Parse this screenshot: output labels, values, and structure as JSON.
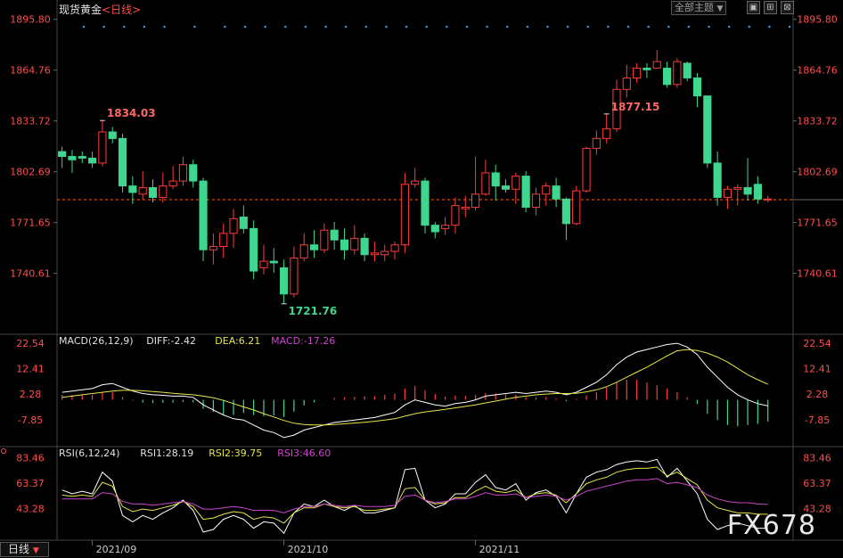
{
  "header": {
    "title": "现货黄金",
    "period_tag": "<日线>",
    "theme_button": "全部主题",
    "theme_arrow": "▼",
    "win_buttons": [
      "▣",
      "⊞",
      "⊠"
    ]
  },
  "bottom": {
    "period_button": "日线",
    "watermark": "FX678"
  },
  "colors": {
    "up": "#ff3b3b",
    "down": "#3fd68f",
    "diff": "#ffffff",
    "dea": "#e6e64a",
    "macd_label": "#cc44cc",
    "rsi1": "#ffffff",
    "rsi2": "#e6e64a",
    "rsi3": "#cc44cc",
    "axis_text": "#ff4d4d",
    "date_text": "#cccccc",
    "ref_line": "#ff6600",
    "dots": "#3a8fd8"
  },
  "chart_data": [
    {
      "type": "candlestick",
      "name": "现货黄金 日线",
      "y_ticks": [
        "1895.80",
        "1864.76",
        "1833.72",
        "1802.69",
        "1771.65",
        "1740.61"
      ],
      "ylim": [
        1705,
        1900
      ],
      "x_ticks": [
        "2021/09",
        "2021/10",
        "2021/11"
      ],
      "current_price_line": 1785.6,
      "annotations": [
        {
          "label": "1834.03",
          "index": 4,
          "kind": "high"
        },
        {
          "label": "1721.76",
          "index": 22,
          "kind": "low"
        },
        {
          "label": "1877.15",
          "index": 54,
          "kind": "high"
        }
      ],
      "candles": [
        [
          1815,
          1812,
          1818,
          1805
        ],
        [
          1812,
          1810,
          1816,
          1802
        ],
        [
          1812,
          1811,
          1815,
          1808
        ],
        [
          1811,
          1808,
          1815,
          1805
        ],
        [
          1808,
          1827,
          1834,
          1806
        ],
        [
          1827,
          1823,
          1830,
          1820
        ],
        [
          1823,
          1794,
          1826,
          1790
        ],
        [
          1794,
          1790,
          1800,
          1783
        ],
        [
          1789,
          1793,
          1803,
          1786
        ],
        [
          1793,
          1787,
          1798,
          1784
        ],
        [
          1787,
          1794,
          1802,
          1784
        ],
        [
          1794,
          1797,
          1806,
          1792
        ],
        [
          1797,
          1807,
          1812,
          1794
        ],
        [
          1807,
          1797,
          1810,
          1793
        ],
        [
          1797,
          1755,
          1799,
          1748
        ],
        [
          1755,
          1757,
          1765,
          1746
        ],
        [
          1757,
          1765,
          1771,
          1750
        ],
        [
          1765,
          1774,
          1780,
          1756
        ],
        [
          1775,
          1768,
          1782,
          1765
        ],
        [
          1768,
          1742,
          1773,
          1737
        ],
        [
          1744,
          1748,
          1758,
          1740
        ],
        [
          1748,
          1747,
          1756,
          1741
        ],
        [
          1744,
          1728,
          1749,
          1722
        ],
        [
          1728,
          1750,
          1757,
          1726
        ],
        [
          1750,
          1758,
          1765,
          1748
        ],
        [
          1758,
          1755,
          1767,
          1750
        ],
        [
          1755,
          1767,
          1771,
          1753
        ],
        [
          1767,
          1761,
          1772,
          1755
        ],
        [
          1761,
          1755,
          1768,
          1749
        ],
        [
          1755,
          1762,
          1770,
          1752
        ],
        [
          1762,
          1752,
          1765,
          1748
        ],
        [
          1752,
          1753,
          1760,
          1748
        ],
        [
          1752,
          1754,
          1758,
          1748
        ],
        [
          1754,
          1758,
          1760,
          1749
        ],
        [
          1758,
          1795,
          1802,
          1753
        ],
        [
          1795,
          1797,
          1805,
          1793
        ],
        [
          1797,
          1770,
          1799,
          1765
        ],
        [
          1770,
          1766,
          1772,
          1762
        ],
        [
          1768,
          1770,
          1775,
          1764
        ],
        [
          1770,
          1782,
          1787,
          1765
        ],
        [
          1780,
          1781,
          1788,
          1775
        ],
        [
          1781,
          1789,
          1812,
          1779
        ],
        [
          1789,
          1802,
          1810,
          1788
        ],
        [
          1802,
          1794,
          1807,
          1785
        ],
        [
          1794,
          1792,
          1798,
          1790
        ],
        [
          1792,
          1800,
          1802,
          1783
        ],
        [
          1800,
          1781,
          1803,
          1778
        ],
        [
          1781,
          1789,
          1793,
          1776
        ],
        [
          1789,
          1794,
          1796,
          1782
        ],
        [
          1794,
          1786,
          1799,
          1781
        ],
        [
          1786,
          1771,
          1787,
          1761
        ],
        [
          1771,
          1791,
          1794,
          1770
        ],
        [
          1791,
          1817,
          1818,
          1790
        ],
        [
          1817,
          1823,
          1828,
          1813
        ],
        [
          1823,
          1829,
          1838,
          1820
        ],
        [
          1829,
          1853,
          1859,
          1827
        ],
        [
          1853,
          1860,
          1868,
          1848
        ],
        [
          1860,
          1866,
          1869,
          1857
        ],
        [
          1866,
          1865,
          1869,
          1860
        ],
        [
          1866,
          1870,
          1877,
          1866
        ],
        [
          1866,
          1856,
          1870,
          1854
        ],
        [
          1856,
          1870,
          1872,
          1854
        ],
        [
          1869,
          1860,
          1870,
          1858
        ],
        [
          1860,
          1849,
          1863,
          1842
        ],
        [
          1849,
          1808,
          1849,
          1805
        ],
        [
          1808,
          1787,
          1815,
          1782
        ],
        [
          1787,
          1792,
          1794,
          1780
        ],
        [
          1792,
          1793,
          1795,
          1782
        ],
        [
          1793,
          1789,
          1811,
          1785
        ],
        [
          1795,
          1786,
          1800,
          1783
        ],
        [
          1786,
          1786,
          1788,
          1784
        ]
      ]
    },
    {
      "type": "line",
      "name": "MACD(26,12,9)",
      "label_title": "MACD(26,12,9)",
      "label_diff": "DIFF:-2.42",
      "label_dea": "DEA:6.21",
      "label_macd": "MACD:-17.26",
      "y_ticks": [
        "22.54",
        "12.41",
        "2.28",
        "-7.85"
      ],
      "ylim": [
        -17.5,
        25
      ],
      "series": [
        {
          "name": "DIFF",
          "values": [
            3,
            3.5,
            4,
            4.5,
            6,
            6.5,
            5,
            3.5,
            2.5,
            2,
            1.8,
            1.5,
            1.5,
            1,
            -2,
            -4,
            -6,
            -7.5,
            -8,
            -10,
            -12,
            -13,
            -15,
            -14,
            -12,
            -11,
            -10,
            -9,
            -8.5,
            -8,
            -7.5,
            -7,
            -6,
            -5,
            -2,
            0,
            -1,
            -2,
            -2.5,
            -1.5,
            -1,
            0,
            1.5,
            2,
            2.5,
            3,
            2.5,
            3,
            3.5,
            3,
            2,
            3,
            5,
            7,
            10,
            14,
            17,
            19,
            20,
            21,
            22,
            22.5,
            21,
            18,
            13,
            9,
            5,
            2,
            0,
            -1.5,
            -2.4
          ]
        },
        {
          "name": "DEA",
          "values": [
            1,
            1.5,
            2,
            2.5,
            3,
            3.5,
            3.8,
            3.8,
            3.6,
            3.3,
            3,
            2.6,
            2.3,
            2,
            1.5,
            0.8,
            -0.2,
            -1.5,
            -2.8,
            -4,
            -5.5,
            -6.8,
            -8.2,
            -9.3,
            -9.8,
            -10,
            -10,
            -9.8,
            -9.5,
            -9.2,
            -8.9,
            -8.5,
            -8,
            -7.5,
            -6.5,
            -5.5,
            -4.8,
            -4.3,
            -3.8,
            -3.2,
            -2.6,
            -2,
            -1.2,
            -0.5,
            0.3,
            1,
            1.5,
            2,
            2.3,
            2.5,
            2.5,
            2.6,
            3.2,
            4,
            5.2,
            7,
            9,
            11,
            13,
            15.2,
            17.5,
            19.5,
            20,
            19.6,
            18.6,
            17,
            15,
            12.5,
            10,
            8,
            6.2
          ]
        },
        {
          "name": "MACD",
          "values": [
            2,
            2,
            2,
            2,
            3,
            3,
            1.2,
            -0.3,
            -1.1,
            -1.3,
            -1.2,
            -1.1,
            -0.8,
            -1,
            -3.5,
            -4.8,
            -5.8,
            -6,
            -5.2,
            -6,
            -6.5,
            -6.2,
            -6.8,
            -4.7,
            -2.2,
            -1,
            0,
            0.8,
            1,
            1.2,
            1.4,
            1.5,
            2,
            2.5,
            4.5,
            5.5,
            3.8,
            2.3,
            1.3,
            1.7,
            1.6,
            2,
            2.7,
            2.5,
            2.2,
            2,
            1,
            1,
            1.2,
            0.5,
            -0.5,
            0.4,
            1.8,
            3,
            4.8,
            7,
            8,
            8,
            7,
            5.8,
            4.5,
            3,
            1,
            -1.6,
            -5.6,
            -8,
            -10,
            -10.5,
            -10,
            -9.5,
            -8.6
          ]
        }
      ]
    },
    {
      "type": "line",
      "name": "RSI(6,12,24)",
      "label_title": "RSI(6,12,24)",
      "label_rsi1": "RSI1:28.19",
      "label_rsi2": "RSI2:39.75",
      "label_rsi3": "RSI3:46.60",
      "y_ticks": [
        "83.46",
        "63.37",
        "43.28"
      ],
      "ylim": [
        20,
        90
      ],
      "series": [
        {
          "name": "RSI1",
          "values": [
            58,
            55,
            57,
            55,
            72,
            65,
            38,
            33,
            38,
            35,
            40,
            44,
            50,
            42,
            25,
            27,
            35,
            38,
            35,
            28,
            33,
            32,
            24,
            40,
            47,
            45,
            50,
            45,
            42,
            46,
            40,
            40,
            42,
            44,
            74,
            75,
            50,
            44,
            47,
            55,
            55,
            64,
            70,
            60,
            58,
            63,
            50,
            56,
            58,
            53,
            40,
            55,
            68,
            72,
            74,
            78,
            80,
            81,
            80,
            82,
            68,
            75,
            65,
            55,
            35,
            27,
            30,
            32,
            30,
            28,
            28
          ]
        },
        {
          "name": "RSI2",
          "values": [
            54,
            53,
            54,
            53,
            64,
            61,
            45,
            41,
            43,
            42,
            44,
            46,
            49,
            45,
            35,
            36,
            39,
            41,
            40,
            35,
            37,
            36,
            32,
            40,
            44,
            44,
            47,
            45,
            44,
            45,
            42,
            42,
            43,
            44,
            59,
            60,
            50,
            47,
            48,
            52,
            52,
            57,
            61,
            57,
            56,
            58,
            52,
            55,
            56,
            54,
            48,
            55,
            63,
            66,
            68,
            72,
            74,
            75,
            75,
            76,
            69,
            72,
            67,
            62,
            50,
            44,
            42,
            40,
            40,
            39,
            39
          ]
        },
        {
          "name": "RSI3",
          "values": [
            51,
            51,
            51,
            51,
            56,
            55,
            49,
            47,
            47,
            46,
            47,
            48,
            49,
            47,
            43,
            43,
            44,
            45,
            44,
            42,
            42,
            42,
            40,
            43,
            45,
            45,
            47,
            46,
            45,
            46,
            45,
            45,
            45,
            46,
            53,
            54,
            50,
            48,
            49,
            51,
            51,
            53,
            56,
            54,
            54,
            55,
            52,
            53,
            54,
            53,
            50,
            53,
            57,
            59,
            61,
            63,
            65,
            66,
            66,
            67,
            63,
            64,
            62,
            60,
            54,
            51,
            49,
            48,
            48,
            47,
            46.6
          ]
        }
      ]
    }
  ]
}
